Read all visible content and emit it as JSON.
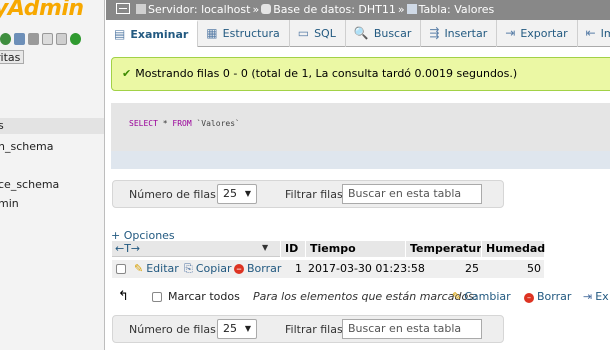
{
  "sidebar": {
    "logo_text": "yAdmin",
    "favorites_label": "ritas",
    "items": [
      {
        "label": "s",
        "selected": true
      },
      {
        "label": "n_schema",
        "selected": false
      },
      {
        "label": "ce_schema",
        "selected": false
      },
      {
        "label": "min",
        "selected": false
      }
    ]
  },
  "breadcrumb": {
    "server": "Servidor: localhost",
    "database": "Base de datos: DHT11",
    "table": "Tabla: Valores"
  },
  "tabs": [
    {
      "label": "Examinar",
      "icon": "browse-icon",
      "active": true
    },
    {
      "label": "Estructura",
      "icon": "structure-icon",
      "active": false
    },
    {
      "label": "SQL",
      "icon": "sql-icon",
      "active": false
    },
    {
      "label": "Buscar",
      "icon": "search-icon",
      "active": false
    },
    {
      "label": "Insertar",
      "icon": "insert-icon",
      "active": false
    },
    {
      "label": "Exportar",
      "icon": "export-icon",
      "active": false
    },
    {
      "label": "Im",
      "icon": "import-icon",
      "active": false
    }
  ],
  "message": {
    "text": "Mostrando filas 0 - 0 (total de 1, La consulta tardó 0.0019 segundos.)",
    "color": "#ebf8a4"
  },
  "sql": {
    "kw1": "SELECT",
    "star": "*",
    "kw2": "FROM",
    "table": "`Valores`"
  },
  "rows_nav": {
    "label": "Número de filas:",
    "value": "25",
    "filter_label": "Filtrar filas:",
    "filter_placeholder": "Buscar en esta tabla"
  },
  "options_label": "+ Opciones",
  "table": {
    "headers": [
      "ID",
      "Tiempo",
      "Temperatura",
      "Humedad"
    ],
    "rows": [
      {
        "edit": "Editar",
        "copy": "Copiar",
        "delete": "Borrar",
        "id": "1",
        "tiempo": "2017-03-30 01:23:58",
        "temperatura": "25",
        "humedad": "50"
      }
    ]
  },
  "bulk": {
    "select_all": "Marcar todos",
    "with_selected": "Para los elementos que están marcados:",
    "change": "Cambiar",
    "delete": "Borrar",
    "export": "Ex"
  },
  "colors": {
    "link": "#235a81",
    "breadcrumb_bg": "#888888",
    "logo": "#f7a800"
  }
}
